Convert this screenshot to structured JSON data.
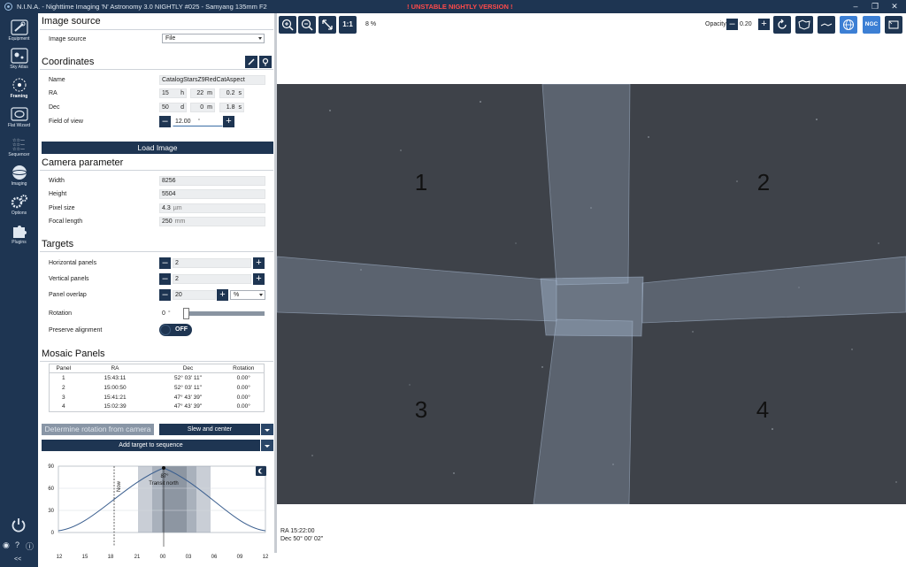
{
  "window": {
    "title": "N.I.N.A. - Nighttime Imaging 'N' Astronomy 3.0 NIGHTLY #025  -  Samyang 135mm F2",
    "warning": "! UNSTABLE NIGHTLY VERSION !"
  },
  "nav": {
    "items": [
      {
        "label": "Equipment",
        "icon": "telescope-icon"
      },
      {
        "label": "Sky Atlas",
        "icon": "atlas-icon"
      },
      {
        "label": "Framing",
        "icon": "framing-icon"
      },
      {
        "label": "Flat Wizard",
        "icon": "flat-wizard-icon"
      },
      {
        "label": "Sequencer",
        "icon": "sequencer-icon"
      },
      {
        "label": "Imaging",
        "icon": "imaging-icon"
      },
      {
        "label": "Options",
        "icon": "gears-icon"
      },
      {
        "label": "Plugins",
        "icon": "puzzle-icon"
      }
    ],
    "collapse": "<<"
  },
  "image_source": {
    "title": "Image source",
    "label": "Image source",
    "value": "File"
  },
  "coordinates": {
    "title": "Coordinates",
    "name_label": "Name",
    "name_value": "CatalogStarsZ9RedCatAspect",
    "ra_label": "RA",
    "ra_h": "15",
    "ra_h_unit": "h",
    "ra_m": "22",
    "ra_m_unit": "m",
    "ra_s": "0.2",
    "ra_s_unit": "s",
    "dec_label": "Dec",
    "dec_d": "50",
    "dec_d_unit": "d",
    "dec_m": "0",
    "dec_m_unit": "m",
    "dec_s": "1.8",
    "dec_s_unit": "s",
    "fov_label": "Field of view",
    "fov_value": "12.00",
    "fov_unit": "°"
  },
  "load_image_label": "Load Image",
  "camera": {
    "title": "Camera parameter",
    "width_label": "Width",
    "width_value": "8256",
    "height_label": "Height",
    "height_value": "5504",
    "pixel_label": "Pixel size",
    "pixel_value": "4.3",
    "pixel_unit": "µm",
    "focal_label": "Focal length",
    "focal_value": "250",
    "focal_unit": "mm"
  },
  "targets": {
    "title": "Targets",
    "hpanels_label": "Horizontal panels",
    "hpanels_value": "2",
    "vpanels_label": "Vertical panels",
    "vpanels_value": "2",
    "overlap_label": "Panel overlap",
    "overlap_value": "20",
    "overlap_unit": "%",
    "rotation_label": "Rotation",
    "rotation_value": "0",
    "rotation_unit": "°",
    "preserve_label": "Preserve alignment",
    "preserve_state": "OFF"
  },
  "mosaic": {
    "title": "Mosaic Panels",
    "headers": [
      "Panel",
      "RA",
      "Dec",
      "Rotation"
    ],
    "rows": [
      [
        "1",
        "15:43:11",
        "52° 03' 11\"",
        "0.00°"
      ],
      [
        "2",
        "15:00:50",
        "52° 03' 11\"",
        "0.00°"
      ],
      [
        "3",
        "15:41:21",
        "47° 43' 39\"",
        "0.00°"
      ],
      [
        "4",
        "15:02:39",
        "47° 43' 39\"",
        "0.00°"
      ]
    ]
  },
  "actions": {
    "determine_rotation": "Determine rotation from camera",
    "slew_center": "Slew and center",
    "add_target": "Add target to sequence"
  },
  "altitude_chart": {
    "y_ticks": [
      "90",
      "60",
      "30",
      "0"
    ],
    "x_ticks": [
      "12",
      "15",
      "18",
      "21",
      "00",
      "03",
      "06",
      "09",
      "12"
    ],
    "now_label": "Now",
    "transit_alt": "87°",
    "transit_label": "Transit north"
  },
  "toolbar": {
    "zoom_pct": "8 %",
    "one_to_one": "1:1",
    "opacity_label": "Opacity",
    "opacity_value": "0.20",
    "ngc_label": "NGC"
  },
  "sky_view": {
    "panel_numbers": [
      "1",
      "2",
      "3",
      "4"
    ],
    "footer_ra": "RA  15:22:00",
    "footer_dec": "Dec  50° 00' 02\""
  },
  "colors": {
    "navy": "#1e3552",
    "warning": "#ff4a4a",
    "sky": "#3e4249",
    "panel_fill": "#9fb4cf"
  }
}
